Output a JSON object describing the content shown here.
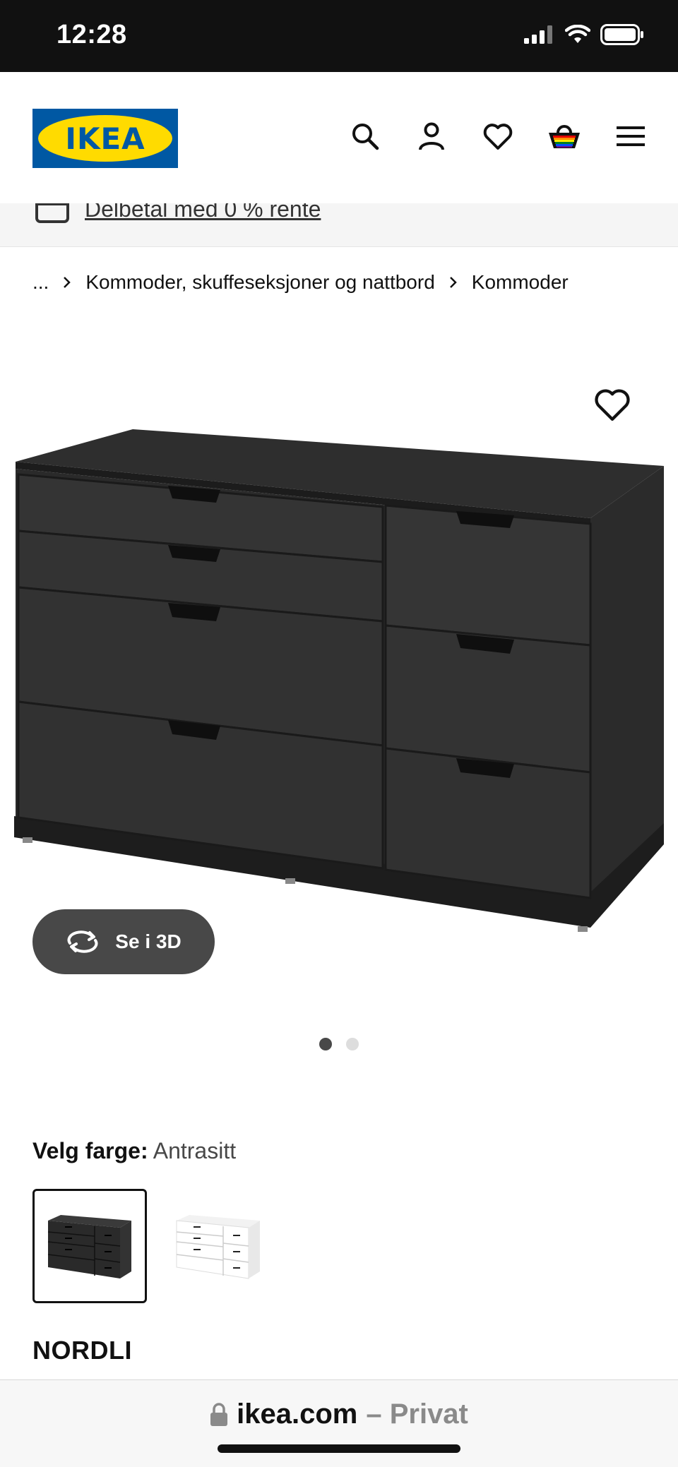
{
  "status_bar": {
    "time": "12:28"
  },
  "header": {
    "logo_text": "IKEA",
    "icons": [
      "search-icon",
      "account-icon",
      "heart-icon",
      "basket-icon",
      "menu-icon"
    ]
  },
  "promo": {
    "text": "Delbetal med 0 % rente"
  },
  "breadcrumb": {
    "items": [
      "...",
      "Kommoder, skuffeseksjoner og nattbord",
      "Kommoder"
    ]
  },
  "product_image": {
    "view_3d_label": "Se i 3D",
    "carousel": {
      "count": 2,
      "active": 1
    }
  },
  "color_selector": {
    "label": "Velg farge:",
    "selected": "Antrasitt",
    "swatches": [
      "anthracite",
      "white"
    ]
  },
  "product": {
    "name": "NORDLI"
  },
  "browser": {
    "domain": "ikea.com",
    "mode": "– Privat"
  },
  "colors": {
    "brand_blue": "#0058a3",
    "brand_yellow": "#ffdb00",
    "dark": "#111111",
    "button_gray": "#484848"
  }
}
